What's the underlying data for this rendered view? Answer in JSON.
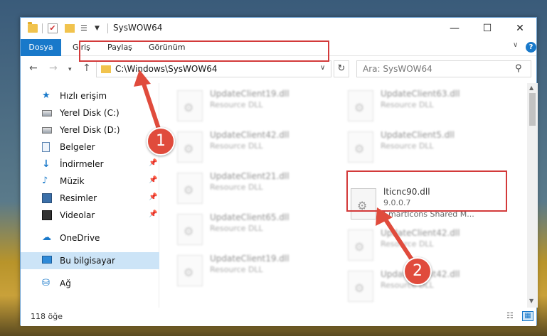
{
  "titlebar": {
    "title": "SysWOW64",
    "minimize": "—",
    "maximize": "☐",
    "close": "✕",
    "quick_access_icons": [
      "folder-icon",
      "properties-check-icon",
      "new-folder-icon",
      "properties-icon",
      "customize-dropdown-icon"
    ]
  },
  "ribbon": {
    "file_tab": "Dosya",
    "tabs": [
      "Giriş",
      "Paylaş",
      "Görünüm"
    ],
    "help": "?"
  },
  "navbar": {
    "address": "C:\\Windows\\SysWOW64",
    "search_placeholder": "Ara: SysWOW64"
  },
  "sidebar": {
    "items": [
      {
        "label": "Hızlı erişim",
        "icon": "star-icon",
        "pinned": false
      },
      {
        "label": "Yerel Disk (C:)",
        "icon": "disk-icon",
        "pinned": false
      },
      {
        "label": "Yerel Disk (D:)",
        "icon": "disk-icon",
        "pinned": false
      },
      {
        "label": "Belgeler",
        "icon": "document-icon",
        "pinned": false
      },
      {
        "label": "İndirmeler",
        "icon": "download-icon",
        "pinned": true
      },
      {
        "label": "Müzik",
        "icon": "music-icon",
        "pinned": true
      },
      {
        "label": "Resimler",
        "icon": "pictures-icon",
        "pinned": true
      },
      {
        "label": "Videolar",
        "icon": "videos-icon",
        "pinned": true
      },
      {
        "label": "OneDrive",
        "icon": "cloud-icon",
        "pinned": false
      },
      {
        "label": "Bu bilgisayar",
        "icon": "computer-icon",
        "pinned": false,
        "selected": true
      },
      {
        "label": "Ağ",
        "icon": "network-icon",
        "pinned": false
      }
    ]
  },
  "files": {
    "col1": [
      {
        "name": "UpdateClient19.dll",
        "sub": "Resource DLL"
      },
      {
        "name": "UpdateClient42.dll",
        "sub": "Resource DLL"
      },
      {
        "name": "UpdateClient21.dll",
        "sub": "Resource DLL"
      },
      {
        "name": "UpdateClient65.dll",
        "sub": "Resource DLL"
      },
      {
        "name": "UpdateClient19.dll",
        "sub": "Resource DLL"
      }
    ],
    "col2": [
      {
        "name": "UpdateClient63.dll",
        "sub": "Resource DLL"
      },
      {
        "name": "UpdateClient5.dll",
        "sub": "Resource DLL"
      },
      {
        "name": "UpdateClient42.dll",
        "sub": "Resource DLL"
      },
      {
        "name": "UpdateClient42.dll",
        "sub": "Resource DLL"
      }
    ],
    "highlighted": {
      "name": "lticnc90.dll",
      "version": "9.0.0.7",
      "description": "SmartIcons Shared M..."
    }
  },
  "statusbar": {
    "count": "118 öğe"
  },
  "callouts": {
    "one": "1",
    "two": "2"
  },
  "colors": {
    "accent": "#1979ca",
    "highlight": "#d33a3a",
    "callout": "#e04b3c"
  }
}
